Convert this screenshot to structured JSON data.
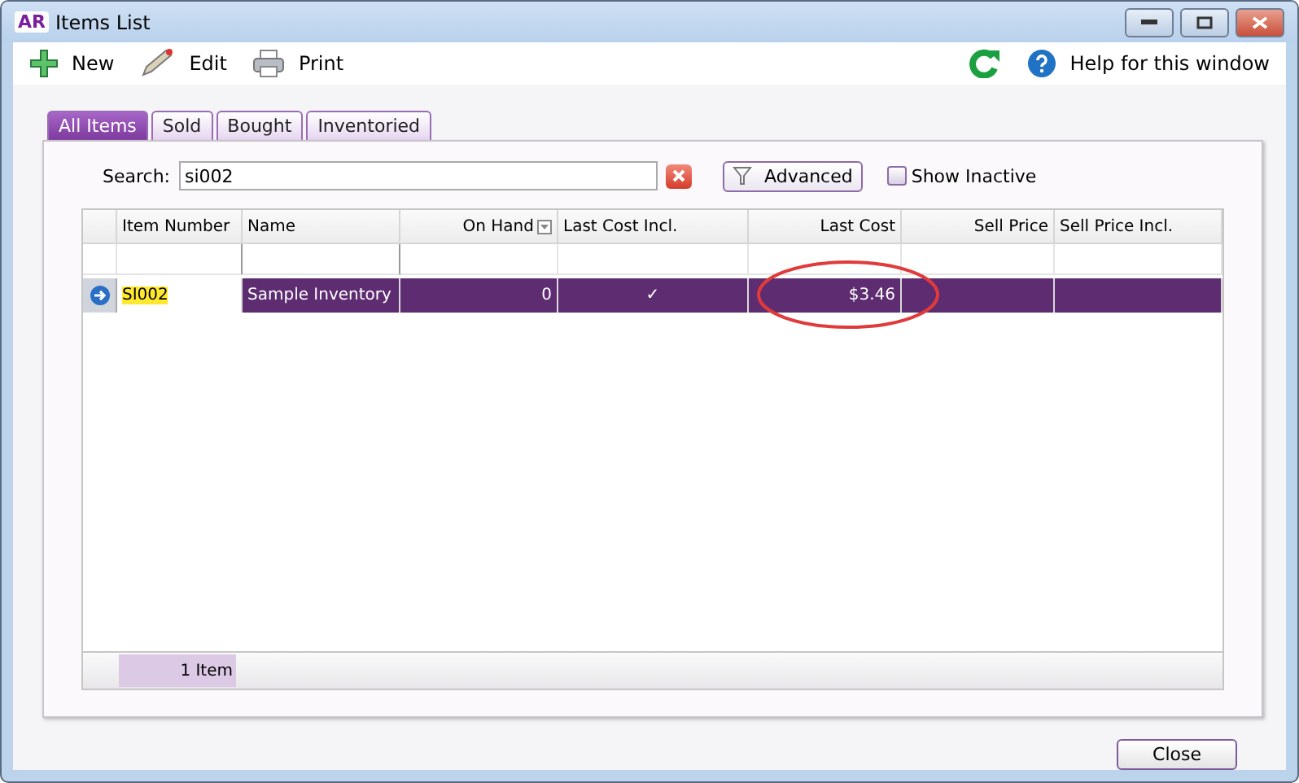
{
  "window": {
    "title": "Items List",
    "app_badge": "AR"
  },
  "toolbar": {
    "left": [
      {
        "label": "New",
        "kind": "new"
      },
      {
        "label": "Edit",
        "kind": "edit"
      },
      {
        "label": "Print",
        "kind": "print"
      }
    ],
    "help": "Help for this window"
  },
  "tabs": [
    {
      "label": "All Items",
      "selected": true
    },
    {
      "label": "Sold",
      "selected": false
    },
    {
      "label": "Bought",
      "selected": false
    },
    {
      "label": "Inventoried",
      "selected": false
    }
  ],
  "search": {
    "label": "Search:",
    "value": "si002"
  },
  "advanced_button": "Advanced",
  "show_inactive": {
    "label": "Show Inactive",
    "checked": false
  },
  "table": {
    "columns": [
      "Item Number",
      "Name",
      "On Hand",
      "Last Cost Incl.",
      "Last Cost",
      "Sell Price",
      "Sell Price Incl."
    ],
    "rows": [
      {
        "selected": true,
        "cells": [
          "SI002",
          "Sample Inventory",
          "0",
          "✓",
          "$3.46",
          "",
          ""
        ]
      }
    ]
  },
  "footer": {
    "count": "1 Item"
  },
  "close_button": "Close"
}
